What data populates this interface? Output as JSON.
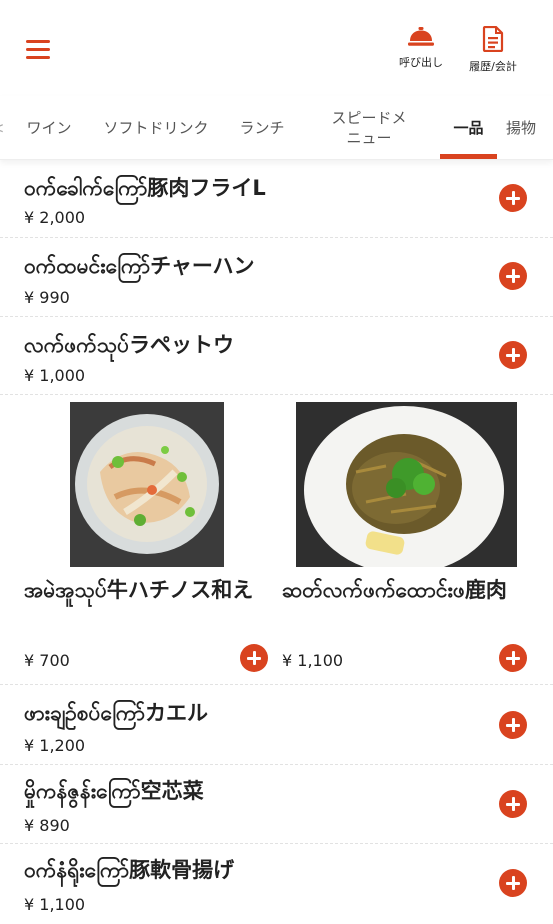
{
  "header": {
    "call_label": "呼び出し",
    "history_label": "履歴/会計",
    "accent_color": "#d9431f"
  },
  "tabs": [
    {
      "label": "ワイン"
    },
    {
      "label": "ソフトドリンク"
    },
    {
      "label": "ランチ"
    },
    {
      "label": "スピードメ\nニュー"
    },
    {
      "label": "一品",
      "active": true
    },
    {
      "label": "揚物"
    }
  ],
  "items": [
    {
      "name": "ဝက်ခေါက်ကြော်豚肉フライL",
      "price": "¥ 2,000"
    },
    {
      "name": "ဝက်ထမင်းကြော်チャーハン",
      "price": "¥ 990"
    },
    {
      "name": "လက်ဖက်သုပ်ラペットウ",
      "price": "¥ 1,000"
    }
  ],
  "cards": [
    {
      "name": "အမဲအူသုပ်牛ハチノス和え",
      "price": "¥ 700",
      "image": "tripe-salad-photo"
    },
    {
      "name": "ဆတ်လက်ဖက်ထောင်းဖ鹿肉",
      "price": "¥ 1,100",
      "image": "venison-dish-photo"
    }
  ],
  "items_bottom": [
    {
      "name": "ဖားချဉ်စပ်ကြော်カエル",
      "price": "¥ 1,200"
    },
    {
      "name": "မှိုကန်ဇွန်းကြော်空芯菜",
      "price": "¥ 890"
    },
    {
      "name": "ဝက်နံရိုးကြော်豚軟骨揚げ",
      "price": "¥ 1,100"
    }
  ]
}
